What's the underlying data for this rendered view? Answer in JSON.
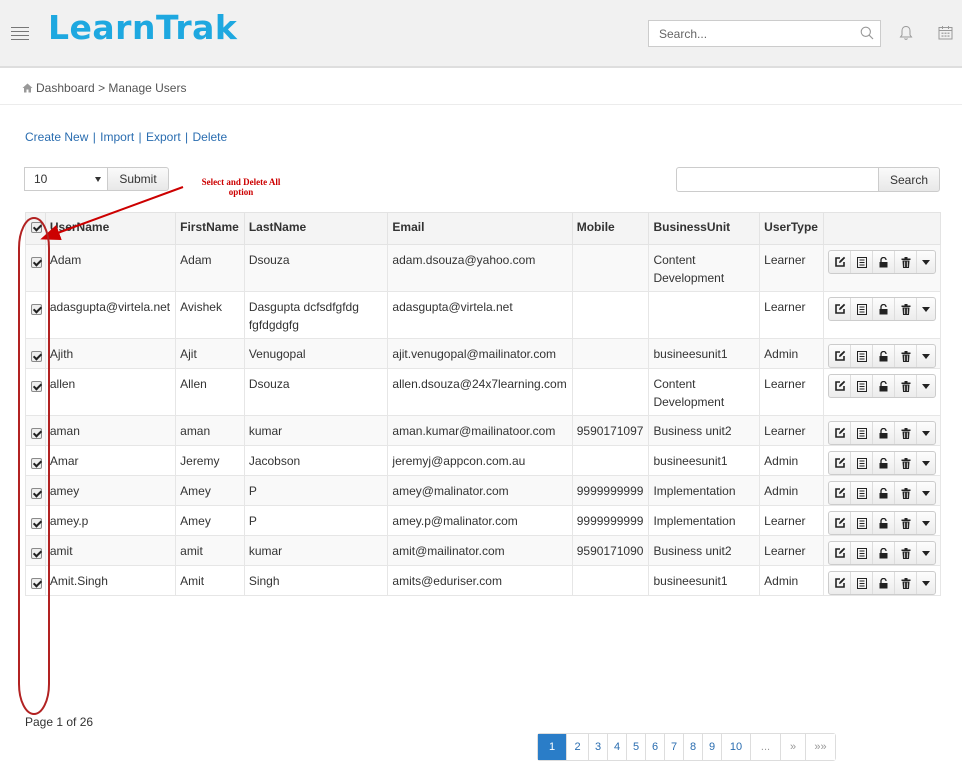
{
  "header": {
    "logo": "LearnTrak",
    "search_placeholder": "Search..."
  },
  "breadcrumb": {
    "home": "Dashboard",
    "separator": ">",
    "current": "Manage Users"
  },
  "actions": {
    "create_new": "Create New",
    "import": "Import",
    "export": "Export",
    "delete": "Delete",
    "separator": "|"
  },
  "toolbar": {
    "page_size": "10",
    "submit_label": "Submit",
    "search_label": "Search"
  },
  "annotation": {
    "line1": "Select and Delete All",
    "line2": "option",
    "color": "#cc0000"
  },
  "table": {
    "headers": {
      "username": "UserName",
      "firstname": "FirstName",
      "lastname": "LastName",
      "email": "Email",
      "mobile": "Mobile",
      "business_unit": "BusinessUnit",
      "usertype": "UserType"
    },
    "rows": [
      {
        "username": "Adam",
        "firstname": "Adam",
        "lastname": "Dsouza",
        "email": "adam.dsouza@yahoo.com",
        "mobile": "",
        "business_unit": "Content Development",
        "usertype": "Learner"
      },
      {
        "username": "adasgupta@virtela.net",
        "firstname": "Avishek",
        "lastname": "Dasgupta dcfsdfgfdg fgfdgdgfg",
        "email": "adasgupta@virtela.net",
        "mobile": "",
        "business_unit": "",
        "usertype": "Learner"
      },
      {
        "username": "Ajith",
        "firstname": "Ajit",
        "lastname": "Venugopal",
        "email": "ajit.venugopal@mailinator.com",
        "mobile": "",
        "business_unit": "busineesunit1",
        "usertype": "Admin"
      },
      {
        "username": "allen",
        "firstname": "Allen",
        "lastname": "Dsouza",
        "email": "allen.dsouza@24x7learning.com",
        "mobile": "",
        "business_unit": "Content Development",
        "usertype": "Learner"
      },
      {
        "username": "aman",
        "firstname": "aman",
        "lastname": "kumar",
        "email": "aman.kumar@mailinatoor.com",
        "mobile": "9590171097",
        "business_unit": "Business unit2",
        "usertype": "Learner"
      },
      {
        "username": "Amar",
        "firstname": "Jeremy",
        "lastname": "Jacobson",
        "email": "jeremyj@appcon.com.au",
        "mobile": "",
        "business_unit": "busineesunit1",
        "usertype": "Admin"
      },
      {
        "username": "amey",
        "firstname": "Amey",
        "lastname": "P",
        "email": "amey@malinator.com",
        "mobile": "9999999999",
        "business_unit": "Implementation",
        "usertype": "Admin"
      },
      {
        "username": "amey.p",
        "firstname": "Amey",
        "lastname": "P",
        "email": "amey.p@malinator.com",
        "mobile": "9999999999",
        "business_unit": "Implementation",
        "usertype": "Learner"
      },
      {
        "username": "amit",
        "firstname": "amit",
        "lastname": "kumar",
        "email": "amit@mailinator.com",
        "mobile": "9590171090",
        "business_unit": "Business unit2",
        "usertype": "Learner"
      },
      {
        "username": "Amit.Singh",
        "firstname": "Amit",
        "lastname": "Singh",
        "email": "amits@eduriser.com",
        "mobile": "",
        "business_unit": "busineesunit1",
        "usertype": "Admin"
      }
    ]
  },
  "footer": {
    "page_info": "Page 1 of 26",
    "pages": [
      "1",
      "2",
      "3",
      "4",
      "5",
      "6",
      "7",
      "8",
      "9",
      "10",
      "...",
      "»",
      "»»"
    ]
  },
  "colors": {
    "brand": "#1ea8e0",
    "link": "#2a6db0",
    "active_page": "#2a7dc8"
  },
  "icons": [
    "menu-icon",
    "search-icon",
    "bell-icon",
    "calendar-icon",
    "home-icon",
    "edit-icon",
    "details-icon",
    "unlock-icon",
    "trash-icon",
    "caret-down-icon"
  ]
}
